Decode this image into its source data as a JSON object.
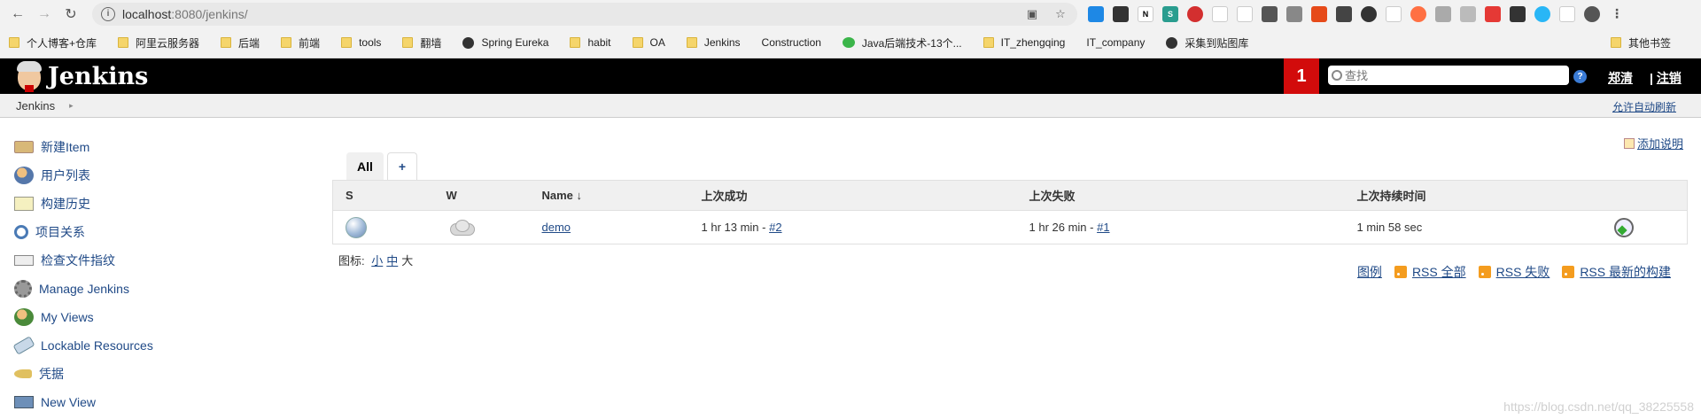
{
  "browser": {
    "url_host": "localhost",
    "url_path": ":8080/jenkins/",
    "bookmarks": [
      "个人博客+仓库",
      "阿里云服务器",
      "后端",
      "前端",
      "tools",
      "翻墙",
      "Spring Eureka",
      "habit",
      "OA",
      "Jenkins",
      "Construction",
      "Java后端技术-13个...",
      "IT_zhengqing",
      "IT_company",
      "采集到贴图库"
    ],
    "bookmarks_other": "其他书签"
  },
  "header": {
    "logo_text": "Jenkins",
    "build_count": "1",
    "search_placeholder": "查找",
    "help": "?",
    "user": "郑清",
    "logout_sep": "|",
    "logout": "注销"
  },
  "breadcrumb": {
    "item": "Jenkins",
    "autorefresh": "允许自动刷新"
  },
  "side": {
    "items": [
      "新建Item",
      "用户列表",
      "构建历史",
      "项目关系",
      "检查文件指纹",
      "Manage Jenkins",
      "My Views",
      "Lockable Resources",
      "凭据",
      "New View"
    ]
  },
  "main": {
    "add_description": "添加说明",
    "tabs": {
      "all": "All",
      "plus": "+"
    },
    "table": {
      "headers": [
        "S",
        "W",
        "Name",
        "上次成功",
        "上次失败",
        "上次持续时间"
      ],
      "sort_arrow": "↓",
      "rows": [
        {
          "name": "demo",
          "last_success": "1 hr 13 min - ",
          "last_success_link": "#2",
          "last_failure": "1 hr 26 min - ",
          "last_failure_link": "#1",
          "last_duration": "1 min 58 sec"
        }
      ]
    },
    "icon_size_label": "图标:",
    "icon_sizes": [
      "小",
      "中",
      "大"
    ],
    "rss": [
      "图例",
      "RSS 全部",
      "RSS 失败",
      "RSS 最新的构建"
    ]
  },
  "watermark": "https://blog.csdn.net/qq_38225558",
  "colors": {
    "header_bg": "#000000",
    "build_badge": "#d20b0b",
    "link": "#204a87"
  }
}
